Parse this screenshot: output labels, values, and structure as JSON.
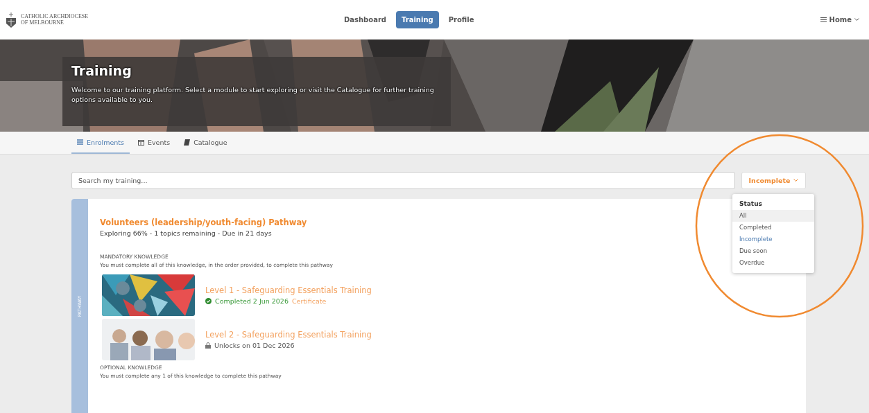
{
  "header": {
    "logo_text": [
      "CATHOLIC ARCHDIOCESE",
      "OF MELBOURNE"
    ],
    "nav": [
      {
        "label": "Dashboard",
        "selected": false
      },
      {
        "label": "Training",
        "selected": true
      },
      {
        "label": "Profile",
        "selected": false
      }
    ],
    "menu": {
      "label": "Home"
    }
  },
  "banner": {
    "title": "Training",
    "text": "Welcome to our training platform. Select a module to start exploring or visit the Catalogue for further training options available to you."
  },
  "tabs": [
    {
      "label": "Enrolments",
      "selected": true
    },
    {
      "label": "Events",
      "selected": false
    },
    {
      "label": "Catalogue",
      "selected": false
    }
  ],
  "search": {
    "placeholder": "Search my training..."
  },
  "filter": {
    "label": "Incomplete",
    "expanded": true,
    "heading": "Status",
    "options": [
      {
        "label": "All",
        "selected": false,
        "hovered": true
      },
      {
        "label": "Completed",
        "selected": false,
        "hovered": false
      },
      {
        "label": "Incomplete",
        "selected": true,
        "hovered": false
      },
      {
        "label": "Due soon",
        "selected": false,
        "hovered": false
      },
      {
        "label": "Overdue",
        "selected": false,
        "hovered": false
      }
    ]
  },
  "pathway": {
    "side_label": "PATHWAY",
    "title": "Volunteers (leadership/youth-facing) Pathway",
    "summary": "Exploring 66% - 1 topics remaining - Due in 21 days",
    "sections": [
      {
        "heading": "MANDATORY KNOWLEDGE",
        "note": "You must complete all of this knowledge, in the order provided, to complete this pathway",
        "items": [
          {
            "kind": "completed",
            "title": "Level 1 - Safeguarding Essentials Training",
            "status": "Completed 2 Jun 2026",
            "link": "Certificate"
          },
          {
            "kind": "locked",
            "title": "Level 2 - Safeguarding Essentials Training",
            "status": "Unlocks on 01 Dec 2026"
          }
        ]
      },
      {
        "heading": "OPTIONAL KNOWLEDGE",
        "note": "You must complete any 1 of this knowledge to complete this pathway"
      }
    ]
  },
  "annotation": {
    "kind": "circle"
  }
}
